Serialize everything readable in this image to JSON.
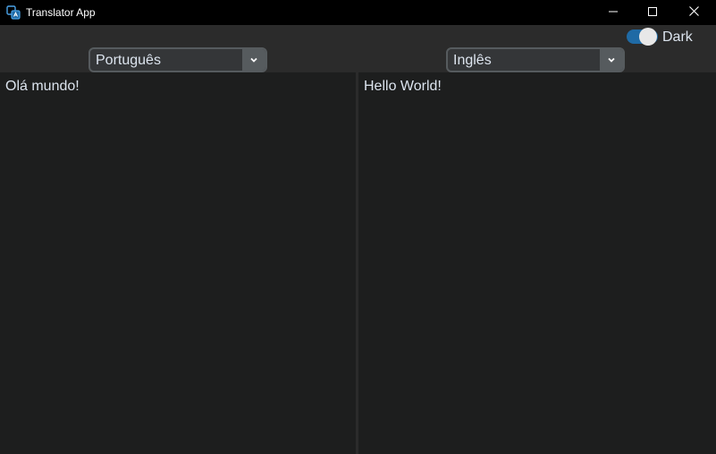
{
  "window": {
    "title": "Translator App",
    "icon": "translate-app-icon",
    "controls": [
      "minimize-icon",
      "maximize-icon",
      "close-icon"
    ]
  },
  "theme_switch": {
    "label": "Dark",
    "checked": true,
    "accent": "#1f6aa5"
  },
  "source": {
    "language": "Português",
    "text": "Olá mundo!"
  },
  "target": {
    "language": "Inglês",
    "text": "Hello World!"
  },
  "colors": {
    "background": "#2b2b2b",
    "pane": "#1d1e1e",
    "combo_bg": "#343638",
    "combo_border": "#565b5e",
    "text": "#dce4ee",
    "titlebar": "#000000"
  }
}
